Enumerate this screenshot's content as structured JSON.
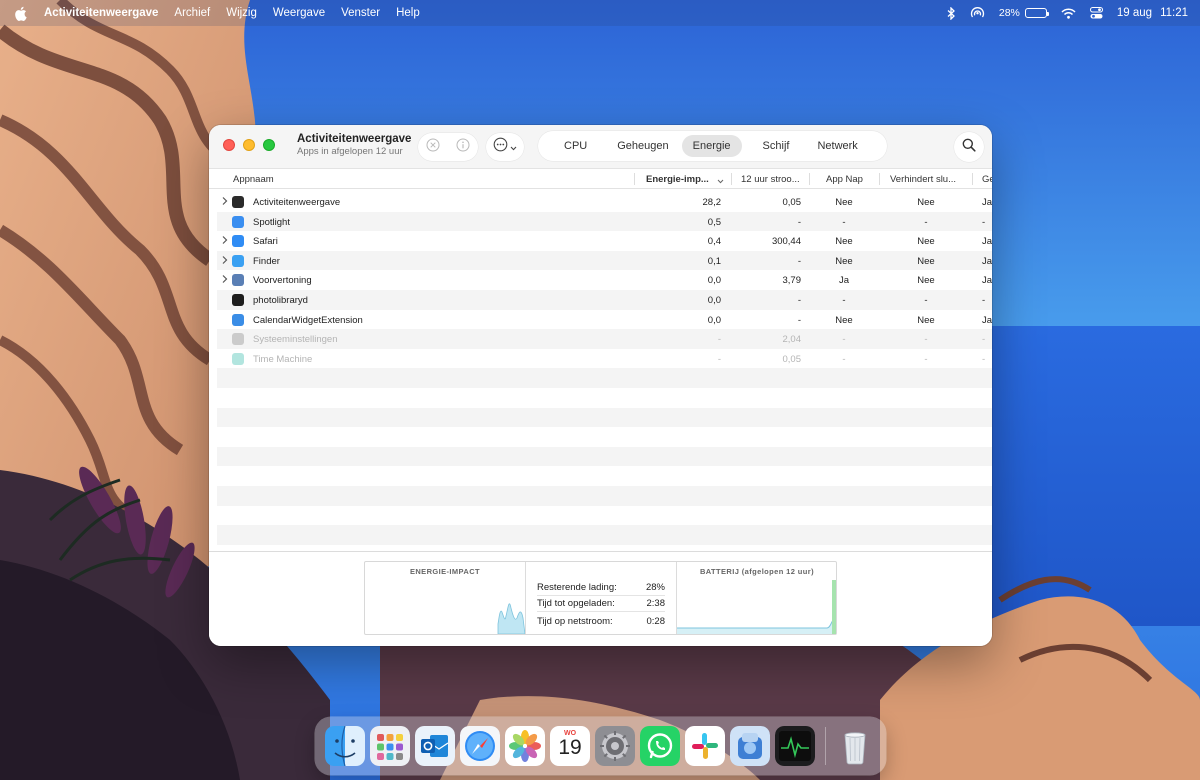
{
  "menubar": {
    "app_name": "Activiteitenweergave",
    "items": [
      "Archief",
      "Wijzig",
      "Weergave",
      "Venster",
      "Help"
    ],
    "battery_percent": "28%",
    "battery_level": 0.28,
    "date": "19 aug",
    "time": "11:21"
  },
  "window": {
    "title": "Activiteitenweergave",
    "subtitle": "Apps in afgelopen 12 uur",
    "tabs": [
      "CPU",
      "Geheugen",
      "Energie",
      "Schijf",
      "Netwerk"
    ],
    "active_tab": "Energie"
  },
  "table": {
    "columns": [
      "Appnaam",
      "Energie-imp...",
      "12 uur stroo...",
      "App Nap",
      "Verhindert slu...",
      "Ge"
    ],
    "rows": [
      {
        "name": "Activiteitenweergave",
        "energy": "28,2",
        "twelve": "0,05",
        "nap": "Nee",
        "sleep": "Nee",
        "ge": "Jas",
        "expand": true,
        "dim": false,
        "icon": "activity-monitor-icon",
        "color": "#2b2b2b"
      },
      {
        "name": "Spotlight",
        "energy": "0,5",
        "twelve": "-",
        "nap": "-",
        "sleep": "-",
        "ge": "-",
        "expand": false,
        "dim": false,
        "icon": "spotlight-icon",
        "color": "#3a8ef0"
      },
      {
        "name": "Safari",
        "energy": "0,4",
        "twelve": "300,44",
        "nap": "Nee",
        "sleep": "Nee",
        "ge": "Jas",
        "expand": true,
        "dim": false,
        "icon": "safari-icon",
        "color": "#2f8cf4"
      },
      {
        "name": "Finder",
        "energy": "0,1",
        "twelve": "-",
        "nap": "Nee",
        "sleep": "Nee",
        "ge": "Jas",
        "expand": true,
        "dim": false,
        "icon": "finder-icon",
        "color": "#3aa0f2"
      },
      {
        "name": "Voorvertoning",
        "energy": "0,0",
        "twelve": "3,79",
        "nap": "Ja",
        "sleep": "Nee",
        "ge": "Jas",
        "expand": true,
        "dim": false,
        "icon": "preview-icon",
        "color": "#5a7fb5"
      },
      {
        "name": "photolibraryd",
        "energy": "0,0",
        "twelve": "-",
        "nap": "-",
        "sleep": "-",
        "ge": "-",
        "expand": false,
        "dim": false,
        "icon": "terminal-icon",
        "color": "#1e1e1e"
      },
      {
        "name": "CalendarWidgetExtension",
        "energy": "0,0",
        "twelve": "-",
        "nap": "Nee",
        "sleep": "Nee",
        "ge": "Jas",
        "expand": false,
        "dim": false,
        "icon": "calendar-widget-icon",
        "color": "#3a8de6"
      },
      {
        "name": "Systeeminstellingen",
        "energy": "-",
        "twelve": "2,04",
        "nap": "-",
        "sleep": "-",
        "ge": "-",
        "expand": false,
        "dim": true,
        "icon": "settings-icon",
        "color": "#9a9a9a"
      },
      {
        "name": "Time Machine",
        "energy": "-",
        "twelve": "0,05",
        "nap": "-",
        "sleep": "-",
        "ge": "-",
        "expand": false,
        "dim": true,
        "icon": "time-machine-icon",
        "color": "#55c6b8"
      }
    ],
    "empty_rows": 9
  },
  "footer": {
    "energy_label": "ENERGIE-IMPACT",
    "battery_label": "BATTERIJ (afgelopen 12 uur)",
    "stats": [
      {
        "label": "Resterende lading:",
        "value": "28%"
      },
      {
        "label": "Tijd tot opgeladen:",
        "value": "2:38"
      },
      {
        "label": "Tijd op netstroom:",
        "value": "0:28"
      }
    ]
  },
  "dock": {
    "calendar_day": "WO",
    "calendar_date": "19",
    "apps": [
      "finder-icon",
      "launchpad-icon",
      "outlook-icon",
      "safari-icon",
      "photos-icon",
      "calendar-icon",
      "system-settings-icon",
      "whatsapp-icon",
      "slack-icon",
      "preview-icon",
      "activity-monitor-icon",
      "trash-icon"
    ]
  },
  "colors": {
    "accent_chart": "#7fd1e8",
    "battery_chart": "#8fd79a"
  }
}
